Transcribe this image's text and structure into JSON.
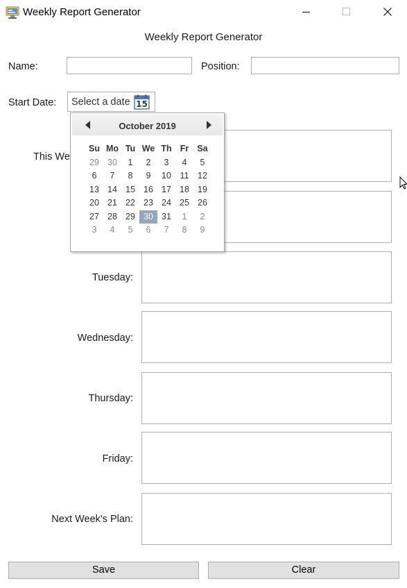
{
  "window": {
    "title": "Weekly Report Generator"
  },
  "header": {
    "title": "Weekly Report Generator"
  },
  "form": {
    "name_label": "Name:",
    "name_value": "",
    "position_label": "Position:",
    "position_value": "",
    "start_date_label": "Start Date:",
    "start_date_placeholder": "Select a date",
    "calendar_icon_text": "15",
    "this_week_label": "This We",
    "tuesday_label": "Tuesday:",
    "wednesday_label": "Wednesday:",
    "thursday_label": "Thursday:",
    "friday_label": "Friday:",
    "next_week_label": "Next Week's Plan:"
  },
  "calendar": {
    "month_label": "October 2019",
    "day_names": [
      "Su",
      "Mo",
      "Tu",
      "We",
      "Th",
      "Fr",
      "Sa"
    ],
    "weeks": [
      [
        {
          "d": "29",
          "o": true
        },
        {
          "d": "30",
          "o": true
        },
        {
          "d": "1"
        },
        {
          "d": "2"
        },
        {
          "d": "3"
        },
        {
          "d": "4"
        },
        {
          "d": "5"
        }
      ],
      [
        {
          "d": "6"
        },
        {
          "d": "7"
        },
        {
          "d": "8"
        },
        {
          "d": "9"
        },
        {
          "d": "10"
        },
        {
          "d": "11"
        },
        {
          "d": "12"
        }
      ],
      [
        {
          "d": "13"
        },
        {
          "d": "14"
        },
        {
          "d": "15"
        },
        {
          "d": "16"
        },
        {
          "d": "17"
        },
        {
          "d": "18"
        },
        {
          "d": "19"
        }
      ],
      [
        {
          "d": "20"
        },
        {
          "d": "21"
        },
        {
          "d": "22"
        },
        {
          "d": "23"
        },
        {
          "d": "24"
        },
        {
          "d": "25"
        },
        {
          "d": "26"
        }
      ],
      [
        {
          "d": "27"
        },
        {
          "d": "28"
        },
        {
          "d": "29"
        },
        {
          "d": "30",
          "s": true
        },
        {
          "d": "31"
        },
        {
          "d": "1",
          "o": true
        },
        {
          "d": "2",
          "o": true
        }
      ],
      [
        {
          "d": "3",
          "o": true
        },
        {
          "d": "4",
          "o": true
        },
        {
          "d": "5",
          "o": true
        },
        {
          "d": "6",
          "o": true
        },
        {
          "d": "7",
          "o": true
        },
        {
          "d": "8",
          "o": true
        },
        {
          "d": "9",
          "o": true
        }
      ]
    ],
    "selected_color": "#8fa8be"
  },
  "buttons": {
    "save_label": "Save",
    "clear_label": "Clear"
  },
  "icons": {
    "app": "report-app-icon",
    "minimize": "minimize-icon",
    "maximize": "maximize-icon",
    "close": "close-icon",
    "calendar": "calendar-icon",
    "prev": "chevron-left-icon",
    "next": "chevron-right-icon",
    "cursor": "mouse-pointer-icon"
  }
}
